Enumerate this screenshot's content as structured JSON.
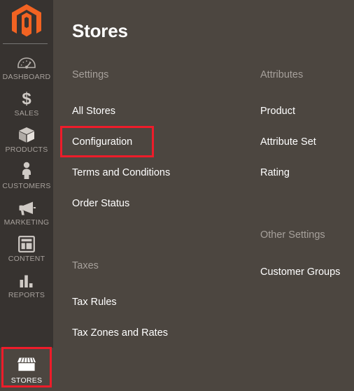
{
  "brand": {
    "logo_icon": "magento-logo-icon",
    "logo_color": "#f26322"
  },
  "sidebar": {
    "items": [
      {
        "label": "DASHBOARD",
        "icon": "gauge-icon",
        "active": false
      },
      {
        "label": "SALES",
        "icon": "dollar-icon",
        "active": false
      },
      {
        "label": "PRODUCTS",
        "icon": "box-icon",
        "active": false
      },
      {
        "label": "CUSTOMERS",
        "icon": "person-icon",
        "active": false
      },
      {
        "label": "MARKETING",
        "icon": "megaphone-icon",
        "active": false
      },
      {
        "label": "CONTENT",
        "icon": "layout-icon",
        "active": false
      },
      {
        "label": "REPORTS",
        "icon": "bar-chart-icon",
        "active": false
      },
      {
        "label": "STORES",
        "icon": "storefront-icon",
        "active": true
      }
    ]
  },
  "header": {
    "title": "Stores"
  },
  "menu": {
    "columns": [
      {
        "groups": [
          {
            "title": "Settings",
            "items": [
              {
                "label": "All Stores"
              },
              {
                "label": "Configuration"
              },
              {
                "label": "Terms and Conditions"
              },
              {
                "label": "Order Status"
              }
            ]
          },
          {
            "title": "Taxes",
            "items": [
              {
                "label": "Tax Rules"
              },
              {
                "label": "Tax Zones and Rates"
              }
            ]
          }
        ]
      },
      {
        "groups": [
          {
            "title": "Attributes",
            "items": [
              {
                "label": "Product"
              },
              {
                "label": "Attribute Set"
              },
              {
                "label": "Rating"
              }
            ]
          },
          {
            "title": "Other Settings",
            "items": [
              {
                "label": "Customer Groups"
              }
            ]
          }
        ]
      }
    ]
  },
  "annotations": {
    "color": "#ee1c2a",
    "boxes": [
      {
        "target": "Configuration"
      },
      {
        "target": "STORES"
      }
    ]
  },
  "colors": {
    "sidebar_bg": "#373330",
    "content_bg": "#4c4640",
    "group_title": "#a6a09b",
    "link": "#ffffff",
    "annotation": "#ee1c2a"
  }
}
